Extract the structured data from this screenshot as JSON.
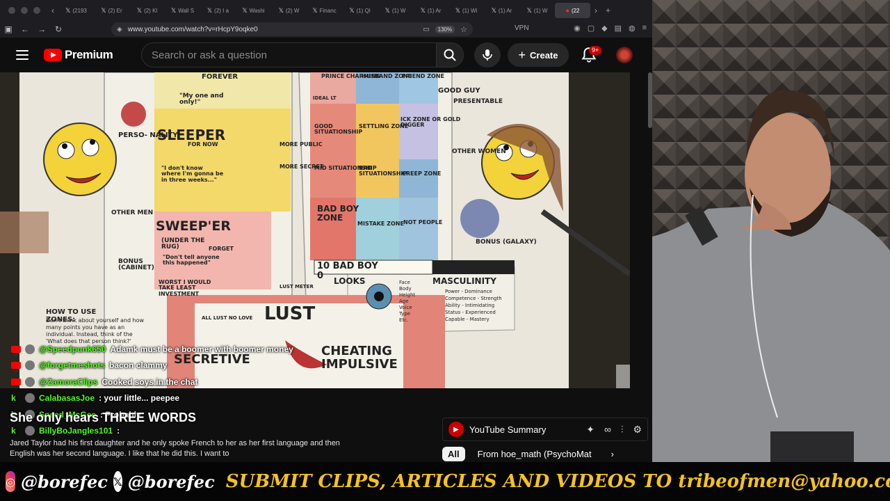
{
  "browser": {
    "tabs": [
      {
        "label": "(2193"
      },
      {
        "label": "(2) Er"
      },
      {
        "label": "(2) Kl"
      },
      {
        "label": "Wall S"
      },
      {
        "label": "(2) I a"
      },
      {
        "label": "Washi"
      },
      {
        "label": "(2) W"
      },
      {
        "label": "Financ"
      },
      {
        "label": "(1) Ql"
      },
      {
        "label": "(1) W"
      },
      {
        "label": "(1) Ar"
      },
      {
        "label": "(1) Wi"
      },
      {
        "label": "(1) Ar"
      },
      {
        "label": "(1) W"
      },
      {
        "label": "(22"
      }
    ],
    "url": "www.youtube.com/watch?v=rHcpY9oqke0",
    "zoom": "130%",
    "vpn_label": "VPN"
  },
  "youtube": {
    "logo_text": "Premium",
    "search_placeholder": "Search or ask a question",
    "create_label": "Create",
    "notification_count": "9+"
  },
  "drawing": {
    "labels": [
      "FOREVER",
      "\"My one and only!\"",
      "PRINCE CHARMING",
      "HUSBAND ZONE",
      "FRIEND ZONE",
      "IDEAL LT",
      "SLEEPER",
      "FOR NOW",
      "\"I don't know where I'm gonna be in three weeks...\"",
      "MORE PUBLIC",
      "MORE SECRET",
      "GOOD SITUATIONSHIP",
      "SETTLING ZONE",
      "ICK ZONE OR GOLD DIGGER",
      "MID SITUATIONSHIP",
      "BAD SITUATIONSHIP",
      "CREEP ZONE",
      "BAD BOY ZONE",
      "MISTAKE ZONE",
      "NOT PEOPLE",
      "SWEEP'ER",
      "(UNDER THE RUG)",
      "FORGET",
      "\"Don't tell anyone this happened\"",
      "WORST I WOULD TAKE LEAST INVESTMENT",
      "PERSO- NALITY",
      "OTHER MEN",
      "BONUS (CABINET)",
      "PRESENTABLE",
      "OTHER WOMEN",
      "BONUS (GALAXY)",
      "GOOD GUY",
      "10 BAD BOY 0",
      "LOOKS",
      "MASCULINITY",
      "LUST METER",
      "LUST",
      "ALL LUST NO LOVE",
      "SECRETIVE",
      "CHEATING IMPULSIVE",
      "HOW TO USE ZONES:"
    ],
    "looks_list": [
      "Face",
      "Body",
      "Height",
      "Age",
      "Voice",
      "Type",
      "Etc."
    ],
    "masculinity_list": [
      "Power - Dominance",
      "Competence - Strength",
      "Ability - Intimidating",
      "Status - Experienced",
      "Capable - Mastery"
    ],
    "how_to_text": "Don't think about yourself and how many points you have as an individual. Instead, think of the 'What does that person think?'"
  },
  "chat": [
    {
      "user": "@Speedpunk650",
      "message": "Adamk must be a boomer with boomer money",
      "platform": "youtube"
    },
    {
      "user": "@forgetmeshots",
      "message": "bacon clammy",
      "platform": "youtube"
    },
    {
      "user": "@ZamoraClips",
      "message": "Cooked soys in the chat",
      "platform": "youtube"
    },
    {
      "user": "CalabasasJoe",
      "message": ": your little... peepee",
      "platform": "kick"
    },
    {
      "user": "Sneed_McGee",
      "message": ": Probably",
      "platform": "kick"
    },
    {
      "user": "BillyBoJangles101",
      "message": ":",
      "platform": "kick"
    }
  ],
  "caption": "She only hears THREE WORDS",
  "description": "Jared Taylor had his first daughter and he only spoke French to her as her first language and then English was her second language. I like that he did this. I want to",
  "summary_panel": {
    "title": "YouTube Summary"
  },
  "chips": [
    {
      "label": "All"
    },
    {
      "label": "From hoe_math (PsychoMat"
    }
  ],
  "banner": {
    "instagram": "@borefec",
    "x": "@borefec",
    "promo": "SUBMIT CLIPS, ARTICLES AND VIDEOS TO tribeofmen@yahoo.com"
  },
  "colors": {
    "yt_red": "#ff0000",
    "kick_green": "#53fc18",
    "promo_yellow": "#f6c21c"
  }
}
